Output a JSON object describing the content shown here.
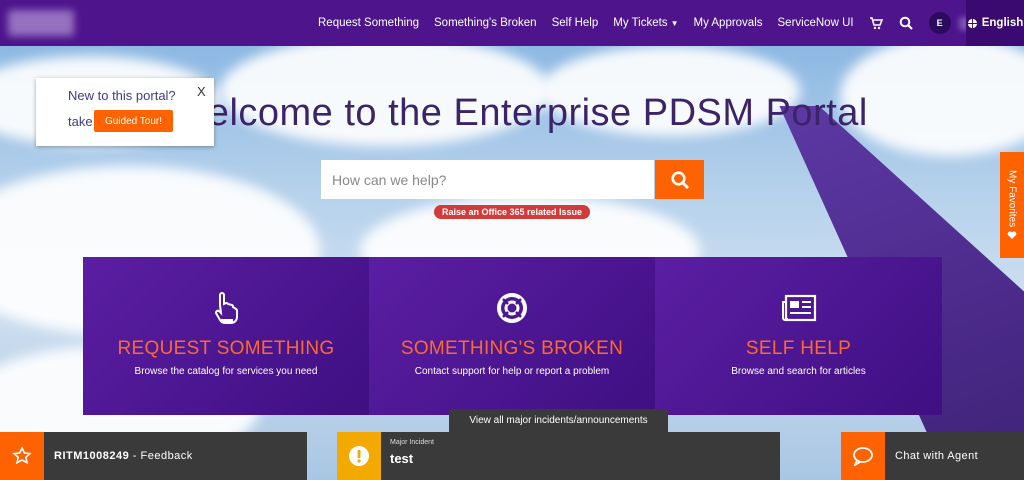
{
  "header": {
    "nav": [
      {
        "label": "Request Something"
      },
      {
        "label": "Something's Broken"
      },
      {
        "label": "Self Help"
      },
      {
        "label": "My Tickets"
      },
      {
        "label": "My Approvals"
      },
      {
        "label": "ServiceNow UI"
      }
    ],
    "avatar_initial": "E",
    "language": "English",
    "icons": {
      "cart": "cart-icon",
      "search": "search-icon",
      "globe": "globe-icon"
    }
  },
  "tour": {
    "text": "New to this portal?",
    "take": "take",
    "button": "Guided Tour!",
    "close": "X"
  },
  "hero": {
    "title": "Welcome to the Enterprise PDSM Portal",
    "search_placeholder": "How can we help?",
    "office_link": "Raise an Office 365 related Issue"
  },
  "favorites": {
    "label": "My Favorites"
  },
  "cards": [
    {
      "title": "REQUEST SOMETHING",
      "subtitle": "Browse the catalog for services you need",
      "icon": "pointer-hand-icon"
    },
    {
      "title": "SOMETHING'S BROKEN",
      "subtitle": "Contact support for help or report a problem",
      "icon": "lifebuoy-icon"
    },
    {
      "title": "SELF HELP",
      "subtitle": "Browse and search for articles",
      "icon": "newspaper-icon"
    }
  ],
  "incidents_link": "View all major incidents/announcements",
  "bottom": {
    "feedback_ticket": "RITM1008249",
    "feedback_label": " - Feedback",
    "incident_label": "Major Incident",
    "incident_value": "test",
    "chat_label": "Chat with Agent"
  },
  "colors": {
    "brand_purple": "#4d148c",
    "accent_orange": "#ff6200",
    "warning": "#f2a900"
  }
}
